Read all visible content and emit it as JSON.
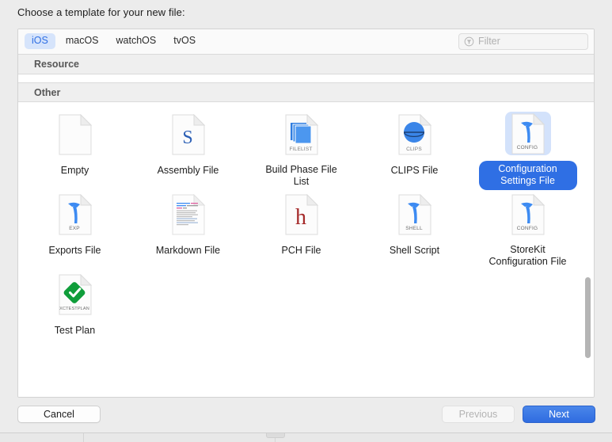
{
  "dialog": {
    "title": "Choose a template for your new file:"
  },
  "toolbar": {
    "tabs": [
      {
        "label": "iOS",
        "selected": true
      },
      {
        "label": "macOS",
        "selected": false
      },
      {
        "label": "watchOS",
        "selected": false
      },
      {
        "label": "tvOS",
        "selected": false
      }
    ],
    "filter": {
      "icon": "filter-icon",
      "value": "",
      "placeholder": "Filter"
    }
  },
  "sections": [
    {
      "header": "Resource"
    },
    {
      "header": "Other"
    }
  ],
  "templates": [
    {
      "label": "Empty",
      "icon": "empty-file-icon",
      "badge": "",
      "selected": false
    },
    {
      "label": "Assembly File",
      "icon": "assembly-file-icon",
      "badge": "S",
      "selected": false
    },
    {
      "label": "Build Phase File List",
      "icon": "build-phase-file-list-icon",
      "badge": "FILELIST",
      "selected": false
    },
    {
      "label": "CLIPS File",
      "icon": "clips-file-icon",
      "badge": "CLIPS",
      "selected": false
    },
    {
      "label": "Configuration Settings File",
      "icon": "configuration-settings-file-icon",
      "badge": "CONFIG",
      "selected": true
    },
    {
      "label": "Exports File",
      "icon": "exports-file-icon",
      "badge": "EXP",
      "selected": false
    },
    {
      "label": "Markdown File",
      "icon": "markdown-file-icon",
      "badge": "",
      "selected": false
    },
    {
      "label": "PCH File",
      "icon": "pch-file-icon",
      "badge": "h",
      "selected": false
    },
    {
      "label": "Shell Script",
      "icon": "shell-script-icon",
      "badge": "SHELL",
      "selected": false
    },
    {
      "label": "StoreKit Configuration File",
      "icon": "storekit-configuration-file-icon",
      "badge": "CONFIG",
      "selected": false
    },
    {
      "label": "Test Plan",
      "icon": "test-plan-icon",
      "badge": "XCTESTPLAN",
      "selected": false
    }
  ],
  "footer": {
    "cancel_label": "Cancel",
    "previous_label": "Previous",
    "next_label": "Next"
  },
  "colors": {
    "accent_blue": "#2f6fe4",
    "selection_tint": "#d3e2fb",
    "tab_selected_bg": "#d6e4fb",
    "icon_blue": "#3d8bf2",
    "pch_red": "#a52a2a",
    "test_green": "#0f9d3a"
  }
}
